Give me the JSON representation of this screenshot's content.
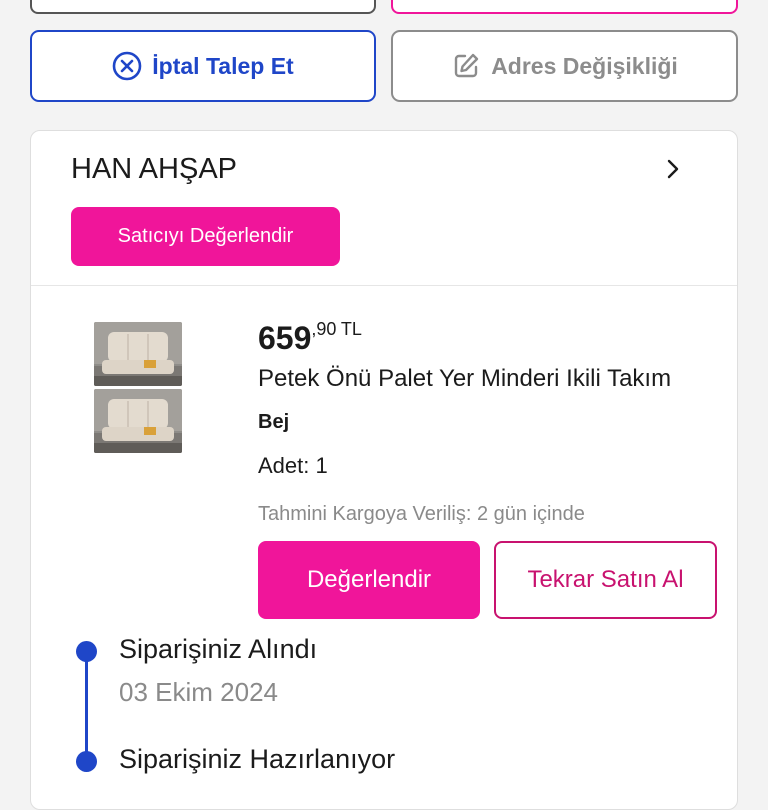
{
  "colors": {
    "brand_pink": "#f0159a",
    "outline_pink": "#c8126f",
    "primary_blue": "#1f46c8",
    "muted_gray": "#8c8c8c"
  },
  "actions": {
    "cancel_label": "İptal Talep Et",
    "cancel_icon": "x-circle-icon",
    "address_label": "Adres Değişikliği",
    "address_icon": "edit-icon"
  },
  "seller": {
    "name": "HAN AHŞAP",
    "rate_label": "Satıcıyı Değerlendir"
  },
  "product": {
    "price_int": "659",
    "price_dec": ",90",
    "currency": "TL",
    "title": "Petek Önü Palet Yer Minderi Ikili Takım",
    "variant": "Bej",
    "quantity": "Adet: 1",
    "shipping": "Tahmini Kargoya Veriliş: 2 gün içinde",
    "rate_label": "Değerlendir",
    "rebuy_label": "Tekrar Satın Al"
  },
  "timeline": [
    {
      "title": "Siparişiniz Alındı",
      "date": "03 Ekim 2024"
    },
    {
      "title": "Siparişiniz Hazırlanıyor"
    }
  ]
}
